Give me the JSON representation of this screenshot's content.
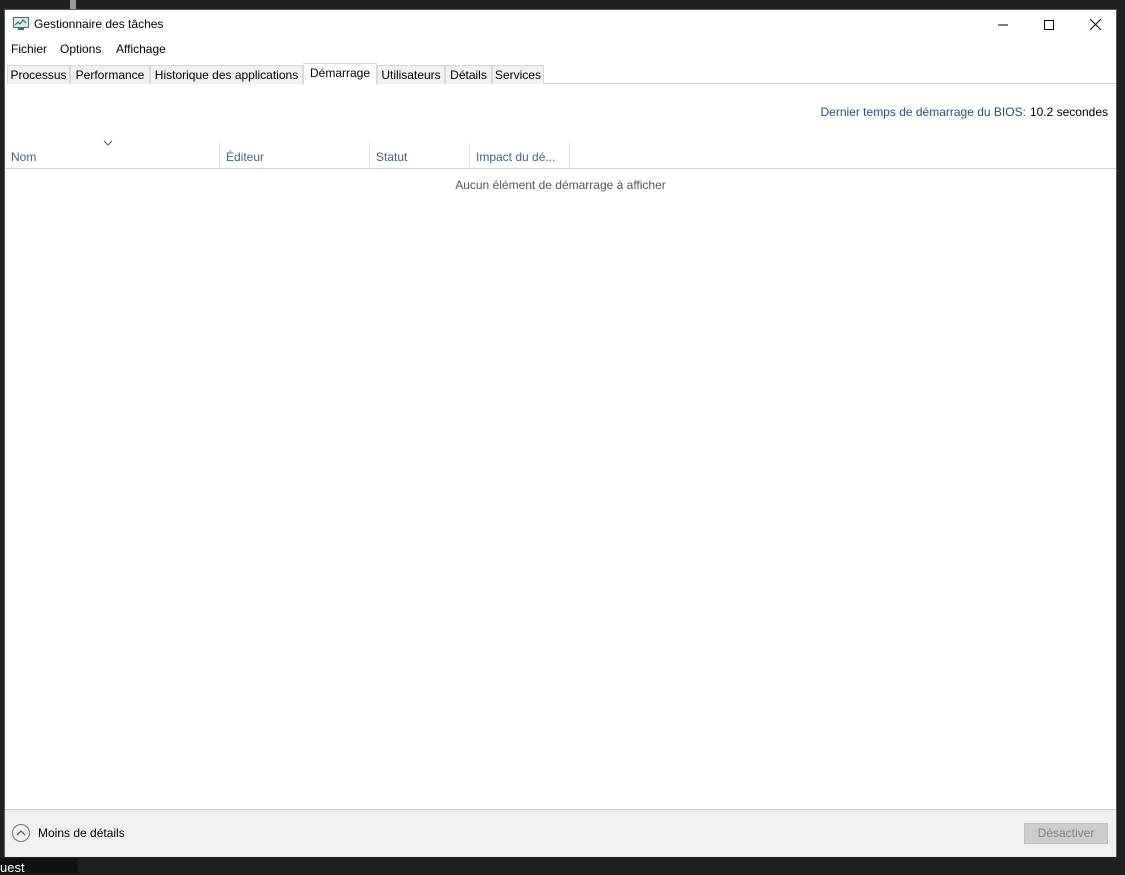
{
  "window": {
    "title": "Gestionnaire des tâches"
  },
  "menu": [
    "Fichier",
    "Options",
    "Affichage"
  ],
  "tabs": [
    "Processus",
    "Performance",
    "Historique des applications",
    "Démarrage",
    "Utilisateurs",
    "Détails",
    "Services"
  ],
  "active_tab": "Démarrage",
  "bios": {
    "label": "Dernier temps de démarrage du BIOS:",
    "value": "10.2 secondes"
  },
  "columns": [
    "Nom",
    "Éditeur",
    "Statut",
    "Impact du dé..."
  ],
  "empty_message": "Aucun élément de démarrage à afficher",
  "footer": {
    "less_details": "Moins de détails",
    "disable_button": "Désactiver"
  },
  "desktop": {
    "bottom_text": "uest"
  },
  "colors": {
    "accent": "#2b4d7a",
    "column_header": "#4d6082"
  }
}
